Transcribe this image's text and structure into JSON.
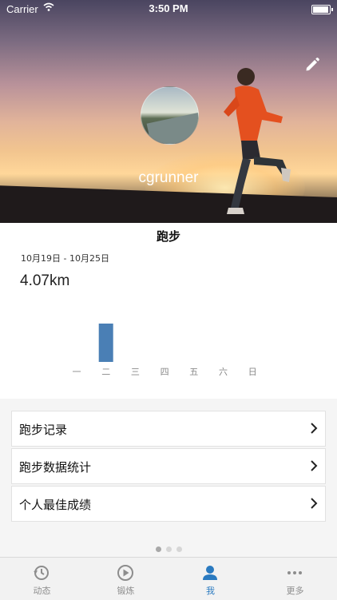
{
  "status_bar": {
    "carrier": "Carrier",
    "time": "3:50 PM"
  },
  "profile": {
    "username": "cgrunner"
  },
  "summary": {
    "title": "跑步",
    "date_range": "10月19日 - 10月25日",
    "distance": "4.07km"
  },
  "chart_data": {
    "type": "bar",
    "categories": [
      "一",
      "二",
      "三",
      "四",
      "五",
      "六",
      "日"
    ],
    "values": [
      0,
      4.07,
      0,
      0,
      0,
      0,
      0
    ],
    "ylabel": "",
    "xlabel": "",
    "color": "#4a7fb5"
  },
  "menu": {
    "items": [
      {
        "label": "跑步记录"
      },
      {
        "label": "跑步数据统计"
      },
      {
        "label": "个人最佳成绩"
      }
    ]
  },
  "pager": {
    "pages": 3,
    "active": 1
  },
  "tabbar": {
    "items": [
      {
        "label": "动态",
        "icon": "history-icon"
      },
      {
        "label": "锻炼",
        "icon": "play-icon"
      },
      {
        "label": "我",
        "icon": "person-icon"
      },
      {
        "label": "更多",
        "icon": "more-icon"
      }
    ],
    "active_index": 2,
    "active_color": "#2a7ac0"
  }
}
